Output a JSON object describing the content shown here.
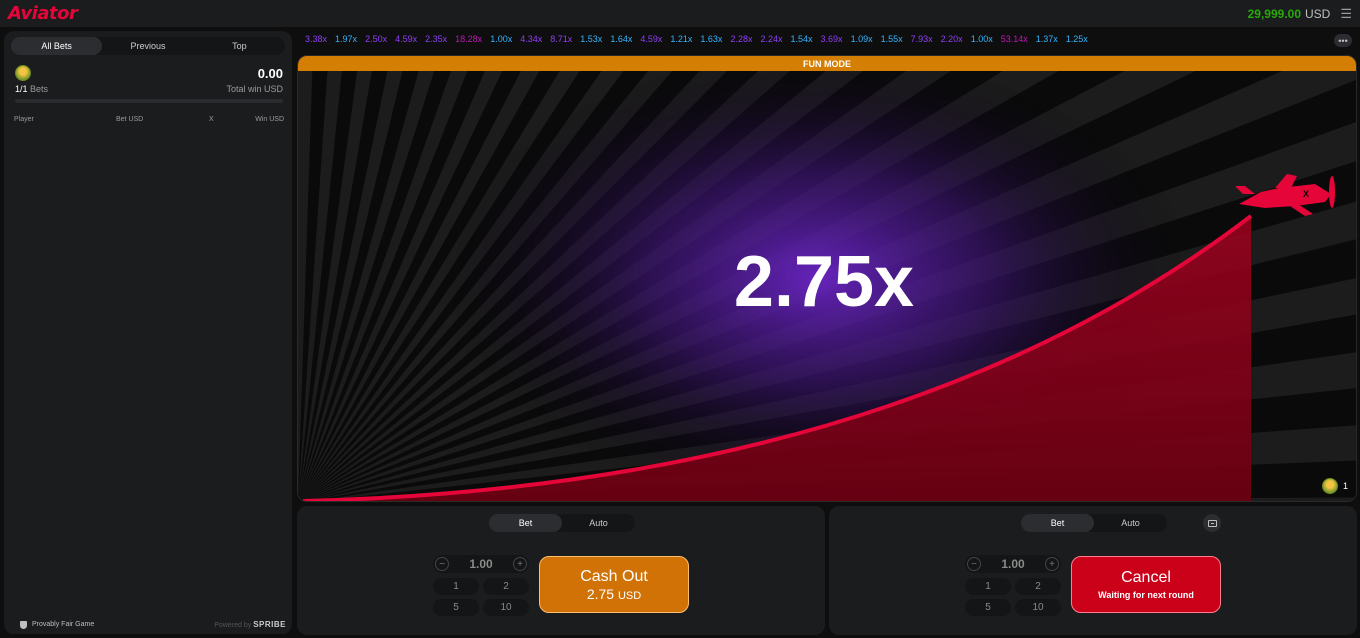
{
  "app": {
    "logo": "Aviator"
  },
  "header": {
    "balance": "29,999.00",
    "currency": "USD",
    "menu_icon": "hamburger-icon"
  },
  "sidebar": {
    "tabs": [
      {
        "label": "All Bets"
      },
      {
        "label": "Previous"
      },
      {
        "label": "Top"
      }
    ],
    "summary": {
      "bets_current": "1/1",
      "bets_label": "Bets",
      "total_win": "0.00",
      "total_win_label": "Total win USD"
    },
    "columns": {
      "player": "Player",
      "bet": "Bet USD",
      "x": "X",
      "win": "Win USD"
    },
    "footer": {
      "fair": "Provably Fair Game",
      "powered_by": "Powered by",
      "brand": "SPRIBE"
    }
  },
  "history": [
    {
      "v": "3.38x",
      "c": "#913ef8"
    },
    {
      "v": "1.97x",
      "c": "#34b4ff"
    },
    {
      "v": "2.50x",
      "c": "#913ef8"
    },
    {
      "v": "4.59x",
      "c": "#913ef8"
    },
    {
      "v": "2.35x",
      "c": "#913ef8"
    },
    {
      "v": "18.28x",
      "c": "#c017b4"
    },
    {
      "v": "1.00x",
      "c": "#34b4ff"
    },
    {
      "v": "4.34x",
      "c": "#913ef8"
    },
    {
      "v": "8.71x",
      "c": "#913ef8"
    },
    {
      "v": "1.53x",
      "c": "#34b4ff"
    },
    {
      "v": "1.64x",
      "c": "#34b4ff"
    },
    {
      "v": "4.59x",
      "c": "#913ef8"
    },
    {
      "v": "1.21x",
      "c": "#34b4ff"
    },
    {
      "v": "1.63x",
      "c": "#34b4ff"
    },
    {
      "v": "2.28x",
      "c": "#913ef8"
    },
    {
      "v": "2.24x",
      "c": "#913ef8"
    },
    {
      "v": "1.54x",
      "c": "#34b4ff"
    },
    {
      "v": "3.69x",
      "c": "#913ef8"
    },
    {
      "v": "1.09x",
      "c": "#34b4ff"
    },
    {
      "v": "1.55x",
      "c": "#34b4ff"
    },
    {
      "v": "7.93x",
      "c": "#913ef8"
    },
    {
      "v": "2.20x",
      "c": "#913ef8"
    },
    {
      "v": "1.00x",
      "c": "#34b4ff"
    },
    {
      "v": "53.14x",
      "c": "#c017b4"
    },
    {
      "v": "1.37x",
      "c": "#34b4ff"
    },
    {
      "v": "1.25x",
      "c": "#34b4ff"
    }
  ],
  "game": {
    "mode_banner": "FUN MODE",
    "multiplier": "2.75x",
    "players_online": "1",
    "plane_color": "#e50539"
  },
  "panels": [
    {
      "tabs": [
        {
          "label": "Bet"
        },
        {
          "label": "Auto"
        }
      ],
      "stake": "1.00",
      "minus": "−",
      "plus": "+",
      "quick": [
        "1",
        "2",
        "5",
        "10"
      ],
      "action": {
        "main": "Cash Out",
        "amount": "2.75",
        "currency": "USD"
      }
    },
    {
      "tabs": [
        {
          "label": "Bet"
        },
        {
          "label": "Auto"
        }
      ],
      "stake": "1.00",
      "minus": "−",
      "plus": "+",
      "quick": [
        "1",
        "2",
        "5",
        "10"
      ],
      "action": {
        "main": "Cancel",
        "sub": "Waiting for next round"
      }
    }
  ],
  "colors": {
    "accent_red": "#e50539",
    "fun_banner": "#d47e04",
    "balance_green": "#28a909",
    "cashout_orange": "#d07206",
    "cancel_red": "#cb011a"
  }
}
